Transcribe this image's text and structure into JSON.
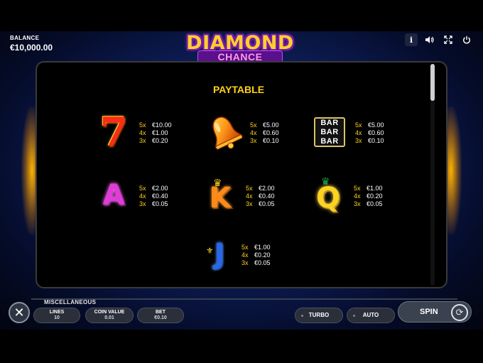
{
  "header": {
    "balance_label": "BALANCE",
    "balance_value": "€10,000.00",
    "logo_top": "DIAMOND",
    "logo_bottom": "CHANCE",
    "info_glyph": "i",
    "sound_glyph": "🔈",
    "fullscreen_glyph": "⤢",
    "power_glyph": "⏻"
  },
  "paytable": {
    "title": "PAYTABLE",
    "symbols": [
      {
        "icon": "seven-icon",
        "glyph": "7",
        "pays": [
          {
            "mult": "5x",
            "amt": "€10.00"
          },
          {
            "mult": "4x",
            "amt": "€1.00"
          },
          {
            "mult": "3x",
            "amt": "€0.20"
          }
        ]
      },
      {
        "icon": "bell-icon",
        "glyph": "",
        "pays": [
          {
            "mult": "5x",
            "amt": "€5.00"
          },
          {
            "mult": "4x",
            "amt": "€0.60"
          },
          {
            "mult": "3x",
            "amt": "€0.10"
          }
        ]
      },
      {
        "icon": "bar-icon",
        "glyph": "BAR",
        "pays": [
          {
            "mult": "5x",
            "amt": "€5.00"
          },
          {
            "mult": "4x",
            "amt": "€0.60"
          },
          {
            "mult": "3x",
            "amt": "€0.10"
          }
        ]
      },
      {
        "icon": "letter-a-icon",
        "glyph": "A",
        "pays": [
          {
            "mult": "5x",
            "amt": "€2.00"
          },
          {
            "mult": "4x",
            "amt": "€0.40"
          },
          {
            "mult": "3x",
            "amt": "€0.05"
          }
        ]
      },
      {
        "icon": "letter-k-icon",
        "glyph": "K",
        "pays": [
          {
            "mult": "5x",
            "amt": "€2.00"
          },
          {
            "mult": "4x",
            "amt": "€0.40"
          },
          {
            "mult": "3x",
            "amt": "€0.05"
          }
        ]
      },
      {
        "icon": "letter-q-icon",
        "glyph": "Q",
        "pays": [
          {
            "mult": "5x",
            "amt": "€1.00"
          },
          {
            "mult": "4x",
            "amt": "€0.20"
          },
          {
            "mult": "3x",
            "amt": "€0.05"
          }
        ]
      },
      {
        "icon": "letter-j-icon",
        "glyph": "J",
        "pays": [
          {
            "mult": "5x",
            "amt": "€1.00"
          },
          {
            "mult": "4x",
            "amt": "€0.20"
          },
          {
            "mult": "3x",
            "amt": "€0.05"
          }
        ]
      }
    ]
  },
  "controls": {
    "close_glyph": "✕",
    "misc_label": "MISCELLANEOUS",
    "lines_label": "LINES",
    "lines_value": "10",
    "coin_label": "COIN VALUE",
    "coin_value": "0.01",
    "bet_label": "BET",
    "bet_value": "€0.10",
    "turbo_label": "TURBO",
    "auto_label": "AUTO",
    "spin_label": "SPIN",
    "spin_glyph": "⟳"
  },
  "colors": {
    "accent_gold": "#ffd11a",
    "background_blue": "#0e1f5c",
    "logo_purple": "#7a1aa8"
  }
}
